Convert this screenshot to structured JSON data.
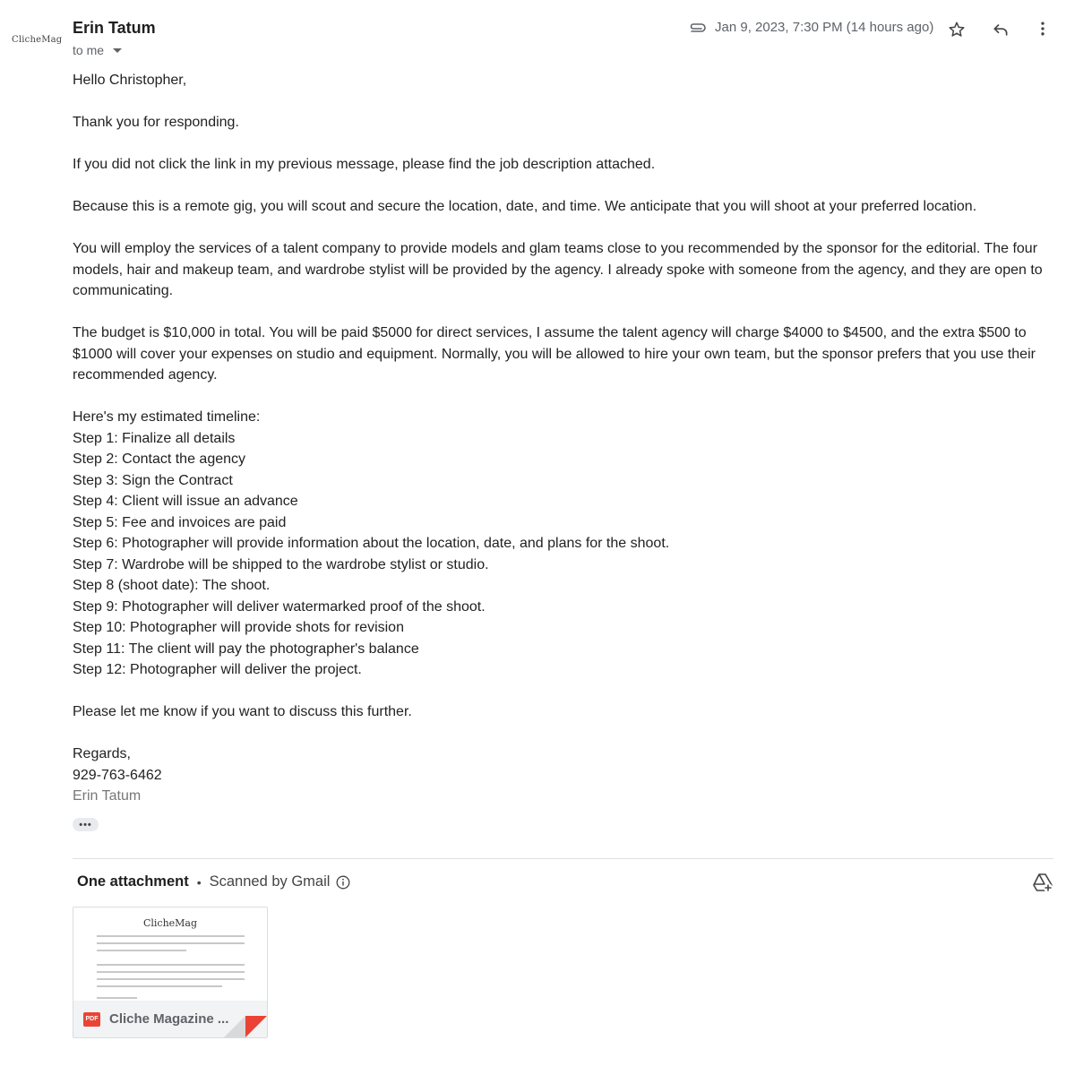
{
  "logo": {
    "text": "ClicheMag"
  },
  "header": {
    "sender": "Erin Tatum",
    "recipient": "to me",
    "date": "Jan 9, 2023, 7:30 PM (14 hours ago)"
  },
  "body": {
    "greeting": "Hello Christopher,",
    "p1": "Thank you for responding.",
    "p2": "If you did not click the link in my previous message, please find the job description attached.",
    "p3": "Because this is a remote gig, you will scout and secure the location, date, and time. We anticipate that you will shoot at your preferred location.",
    "p4": "You will employ the services of a talent company to provide models and glam teams close to you recommended by the sponsor for the editorial. The four models, hair and makeup team, and wardrobe stylist will be provided by the agency. I already spoke with someone from the agency, and they are open to communicating.",
    "p5": "The budget is $10,000 in total. You will be paid $5000 for direct services, I assume the talent agency will charge $4000 to $4500, and the extra $500 to $1000 will cover your expenses on studio and equipment. Normally, you will be allowed to hire your own team, but the sponsor prefers that you use their recommended agency.",
    "timeline_intro": "Here's my estimated timeline:",
    "steps": [
      "Step 1: Finalize all details",
      "Step 2: Contact the agency",
      "Step 3: Sign the Contract",
      "Step 4: Client will issue an advance",
      "Step 5: Fee and invoices are paid",
      "Step 6: Photographer will provide information about the location, date, and plans for the shoot.",
      "Step 7: Wardrobe will be shipped to the wardrobe stylist or studio.",
      "Step 8 (shoot date): The shoot.",
      "Step 9: Photographer will deliver watermarked proof of the shoot.",
      "Step 10: Photographer will provide shots for revision",
      "Step 11: The client will pay the photographer's balance",
      "Step 12: Photographer will deliver the project."
    ],
    "closing": "Please let me know if you want to discuss this further.",
    "regards": "Regards,",
    "phone": "929-763-6462",
    "signature": "Erin Tatum",
    "ellipsis": "•••"
  },
  "attachments": {
    "title": "One attachment",
    "separator": "•",
    "scanned": "Scanned by Gmail",
    "file": {
      "badge": "PDF",
      "name": "Cliche Magazine ...",
      "preview_title": "ClicheMag"
    }
  },
  "colors": {
    "pdf_red": "#ea4335",
    "muted_text": "#5f6368",
    "chip_bg": "#f1f3f4"
  }
}
